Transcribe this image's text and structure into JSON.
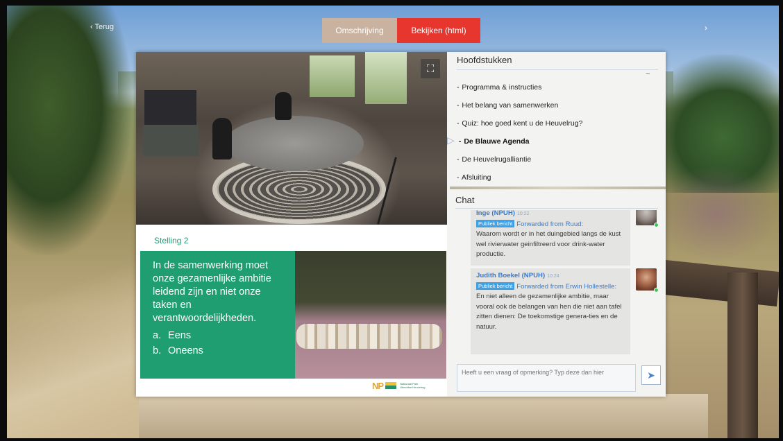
{
  "nav": {
    "back_label": "‹ Terug",
    "next_label": "›",
    "tabs": [
      {
        "label": "Omschrijving",
        "active": false
      },
      {
        "label": "Bekijken (html)",
        "active": true
      }
    ]
  },
  "video": {
    "fullscreen_icon": "⛶"
  },
  "slide": {
    "title": "Stelling 2",
    "statement": "In de samenwerking moet onze gezamenlijke ambitie leidend zijn en niet onze taken en verantwoordelijkheden.",
    "options": [
      {
        "letter": "a.",
        "text": "Eens"
      },
      {
        "letter": "b.",
        "text": "Oneens"
      }
    ],
    "logo_mark": "NP",
    "logo_text_line1": "Nationaal Park",
    "logo_text_line2": "Utrechtse Heuvelrug"
  },
  "chapters": {
    "header": "Hoofdstukken",
    "collapse_symbol": "–",
    "items": [
      "Programma & instructies",
      "Het belang van samenwerken",
      "Quiz: hoe goed kent u de Heuvelrug?",
      "De Blauwe Agenda",
      "De Heuvelrugalliantie",
      "Afsluiting"
    ],
    "active_index": 3
  },
  "chat": {
    "header": "Chat",
    "messages": [
      {
        "author": "Inge (NPUH)",
        "time": "10:22",
        "badge": "Publiek bericht",
        "forwarded": "Forwarded from Ruud:",
        "text": "Waarom wordt er in het duingebied langs de kust wel rivierwater geinfiltreerd voor drink-water productie."
      },
      {
        "author": "Judith Boekel (NPUH)",
        "time": "10:24",
        "badge": "Publiek bericht",
        "forwarded": "Forwarded from Erwin Hollestelle:",
        "text": "En niet alleen de gezamenlijke ambitie, maar vooral ook de belangen van hen die niet aan tafel zitten dienen: De toekomstige genera-ties en de natuur."
      }
    ],
    "input_placeholder": "Heeft u een vraag of opmerking? Typ deze dan hier",
    "send_icon": "➤"
  },
  "colors": {
    "accent_red": "#e6362e",
    "tab_inactive": "#c9b3a0",
    "slide_green": "#1f9e72",
    "chat_link_blue": "#3a79c9",
    "badge_blue": "#3ea1e6"
  }
}
